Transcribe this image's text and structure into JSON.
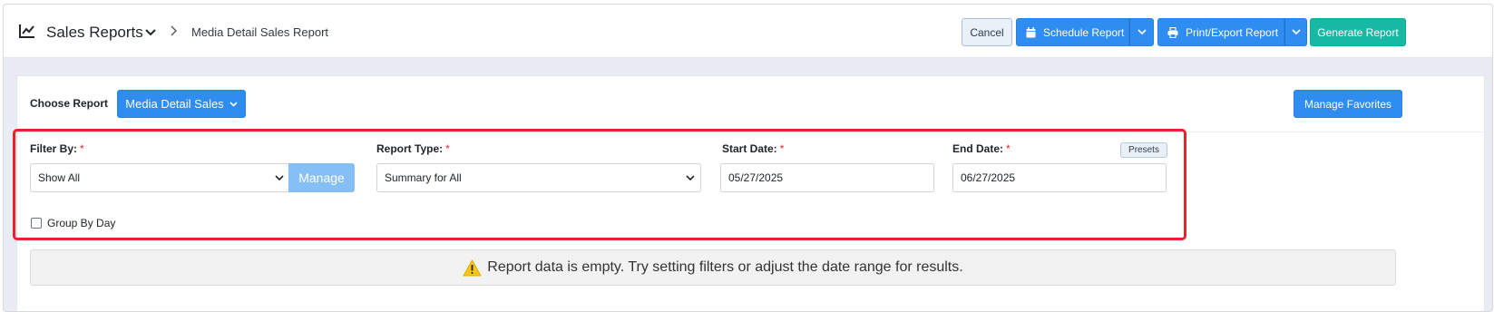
{
  "header": {
    "title": "Sales Reports",
    "breadcrumb": "Media Detail Sales Report",
    "buttons": {
      "cancel": "Cancel",
      "schedule": "Schedule Report",
      "print_export": "Print/Export Report",
      "generate": "Generate Report"
    }
  },
  "report_chooser": {
    "label": "Choose Report",
    "selected": "Media Detail Sales",
    "favorites": "Manage Favorites"
  },
  "filters": {
    "filter_by": {
      "label": "Filter By:",
      "value": "Show All",
      "manage": "Manage"
    },
    "report_type": {
      "label": "Report Type:",
      "value": "Summary for All"
    },
    "start_date": {
      "label": "Start Date:",
      "value": "05/27/2025"
    },
    "end_date": {
      "label": "End Date:",
      "value": "06/27/2025"
    },
    "presets": "Presets",
    "required_mark": "*",
    "group_by_day": {
      "label": "Group By Day",
      "checked": false
    }
  },
  "message": {
    "text": "Report data is empty. Try setting filters or adjust the date range for results."
  },
  "colors": {
    "primary": "#2f8cf0",
    "teal": "#17b9a5",
    "highlight": "#e8242b",
    "warning": "#f5c518"
  }
}
